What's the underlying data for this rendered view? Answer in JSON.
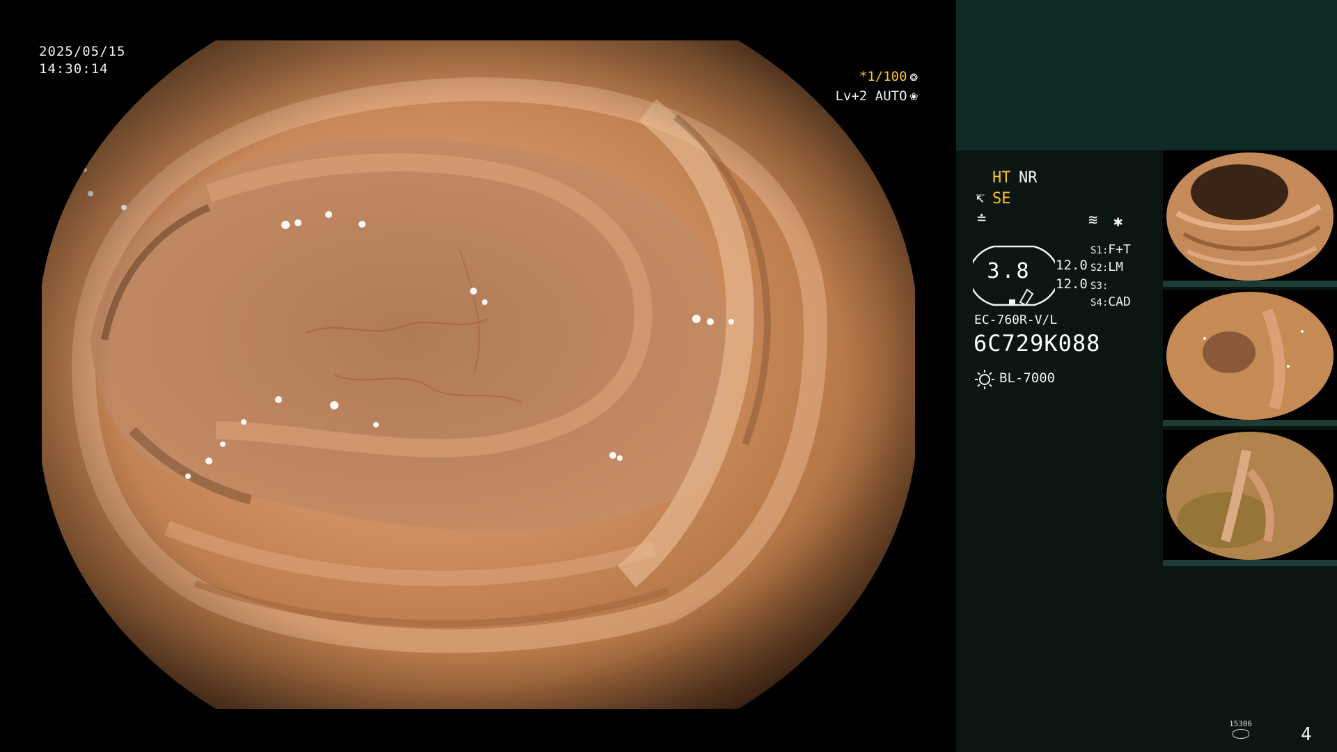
{
  "overlay": {
    "date": "2025/05/15",
    "time": "14:30:14",
    "shutter": "*1/100",
    "exposure": "Lv+2 AUTO"
  },
  "panel": {
    "ht": "HT",
    "nr": "NR",
    "se": "SE",
    "gauge_value": "3.8",
    "levels": [
      "12.0",
      "12.0"
    ],
    "switches": [
      {
        "key": "S1:",
        "value": "F+T"
      },
      {
        "key": "S2:",
        "value": "LM"
      },
      {
        "key": "S3:",
        "value": ""
      },
      {
        "key": "S4:",
        "value": "CAD"
      }
    ],
    "scope_model": "EC-760R-V/L",
    "scope_serial": "6C729K088",
    "light_source": "BL-7000"
  },
  "footer": {
    "storage_count": "15306",
    "page_number": "4"
  },
  "colors": {
    "accent_orange": "#ffc21a",
    "panel_bg": "#0b1613",
    "panel_top_bg": "#102b26"
  }
}
